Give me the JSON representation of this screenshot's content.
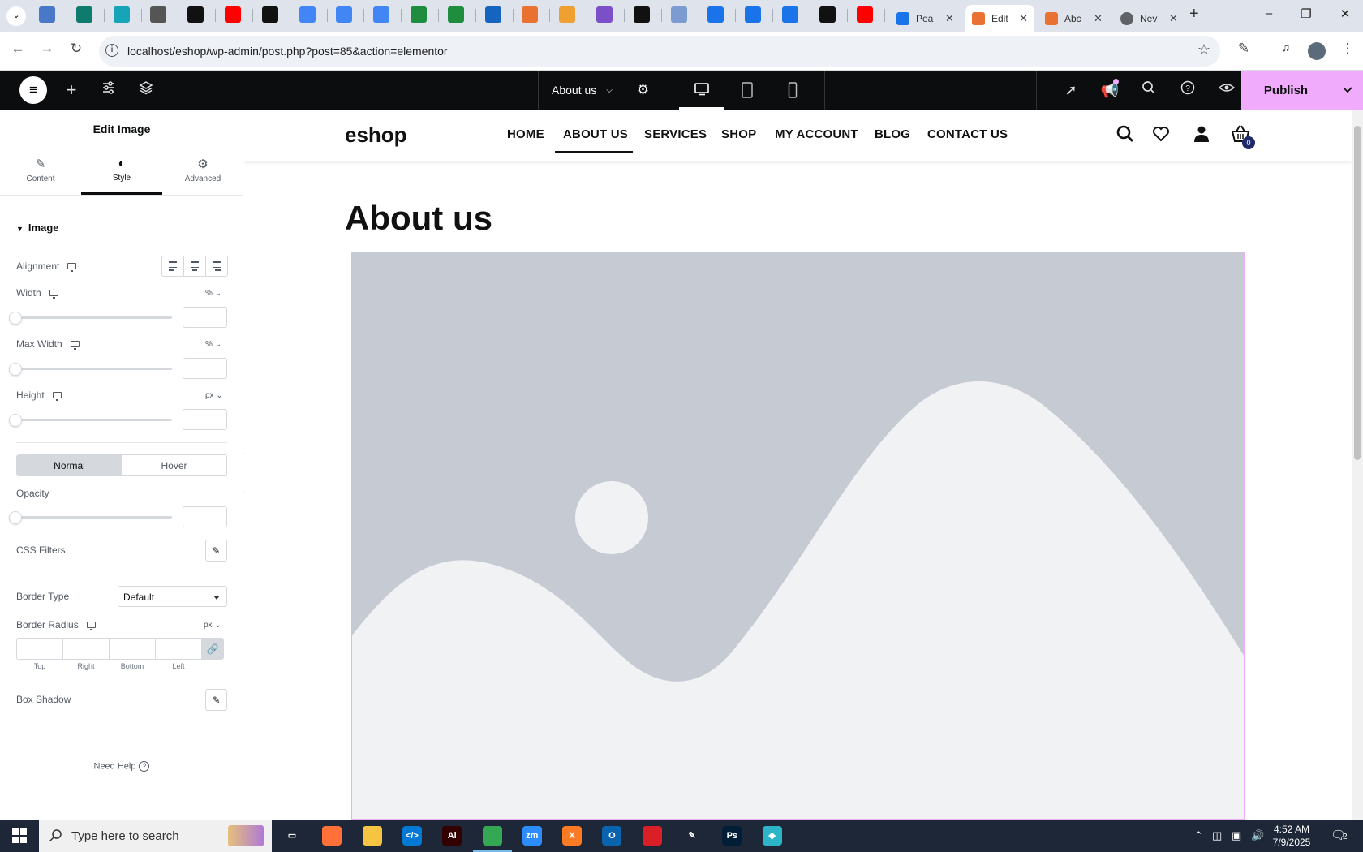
{
  "browser": {
    "tabs": [
      {
        "label": "Pea",
        "color": "#1a73e8",
        "active": false
      },
      {
        "label": "Edit",
        "color": "#e97132",
        "active": true
      },
      {
        "label": "Abc",
        "color": "#e97132",
        "active": false
      },
      {
        "label": "Nev",
        "color": "#5f6368",
        "active": false
      }
    ],
    "pinned_tab_colors": [
      "#4a78c8",
      "#0f7b6c",
      "#16a5b8",
      "#555555",
      "#111111",
      "#ff0000",
      "#111111",
      "#4285f4",
      "#4285f4",
      "#4285f4",
      "#1e8e3e",
      "#1e8e3e",
      "#1565c0",
      "#e97132",
      "#f0a030",
      "#7b4fc8",
      "#111111",
      "#7c9bd0",
      "#1a73e8",
      "#1a73e8",
      "#1a73e8",
      "#111111",
      "#ff0000"
    ],
    "url": "localhost/eshop/wp-admin/post.php?post=85&action=elementor"
  },
  "elementor": {
    "page_name": "About us",
    "publish_label": "Publish",
    "accent": "#f0abfc"
  },
  "panel": {
    "title": "Edit Image",
    "tabs": [
      {
        "label": "Content",
        "icon": "pencil-icon"
      },
      {
        "label": "Style",
        "icon": "contrast-icon"
      },
      {
        "label": "Advanced",
        "icon": "gear-icon"
      }
    ],
    "section": "Image",
    "alignment_label": "Alignment",
    "width_label": "Width",
    "width_unit": "%",
    "max_width_label": "Max Width",
    "max_width_unit": "%",
    "height_label": "Height",
    "height_unit": "px",
    "state_normal": "Normal",
    "state_hover": "Hover",
    "opacity_label": "Opacity",
    "css_filters_label": "CSS Filters",
    "border_type_label": "Border Type",
    "border_type_value": "Default",
    "border_radius_label": "Border Radius",
    "border_radius_unit": "px",
    "radius_fields": [
      "Top",
      "Right",
      "Bottom",
      "Left"
    ],
    "box_shadow_label": "Box Shadow",
    "need_help": "Need Help"
  },
  "site": {
    "logo": "eshop",
    "menu": [
      "HOME",
      "ABOUT US",
      "SERVICES",
      "SHOP",
      "MY ACCOUNT",
      "BLOG",
      "CONTACT US"
    ],
    "active_menu": "ABOUT US",
    "cart_count": "0",
    "heading": "About us",
    "placeholder_colors": {
      "sky": "#c6cbd3",
      "land": "#f1f2f3"
    }
  },
  "taskbar": {
    "search_placeholder": "Type here to search",
    "time": "4:52 AM",
    "date": "7/9/2025",
    "notifications": "2"
  }
}
